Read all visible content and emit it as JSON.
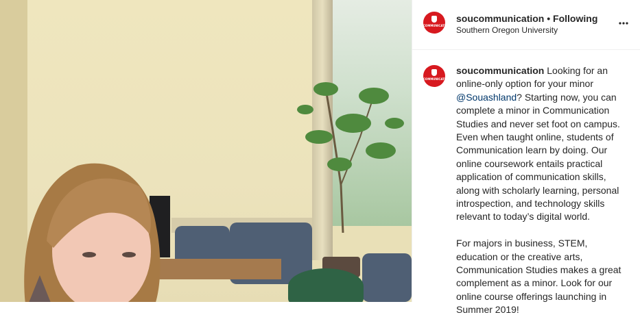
{
  "post": {
    "account": "soucommunication",
    "separator": "•",
    "follow_status": "Following",
    "location": "Southern Oregon University",
    "avatar_text": "COMMUNICATION",
    "caption_user": "soucommunication",
    "caption_p1_a": " Looking for an online-only option for your minor ",
    "caption_mention": "@Souashland",
    "caption_p1_b": "? Starting now, you can complete a minor in Communication Studies and never set foot on campus. Even when taught online, students of Communication learn by doing. Our online coursework entails practical application of communication skills, along with scholarly learning, personal introspection, and technology skills relevant to today’s digital world.",
    "caption_p2": "For majors in business, STEM, education or the creative arts, Communication Studies makes a great complement as a minor. Look for our online course offerings launching in Summer 2019!"
  },
  "icons": {
    "more": "more-options-icon",
    "brand_color": "#d7191f"
  }
}
